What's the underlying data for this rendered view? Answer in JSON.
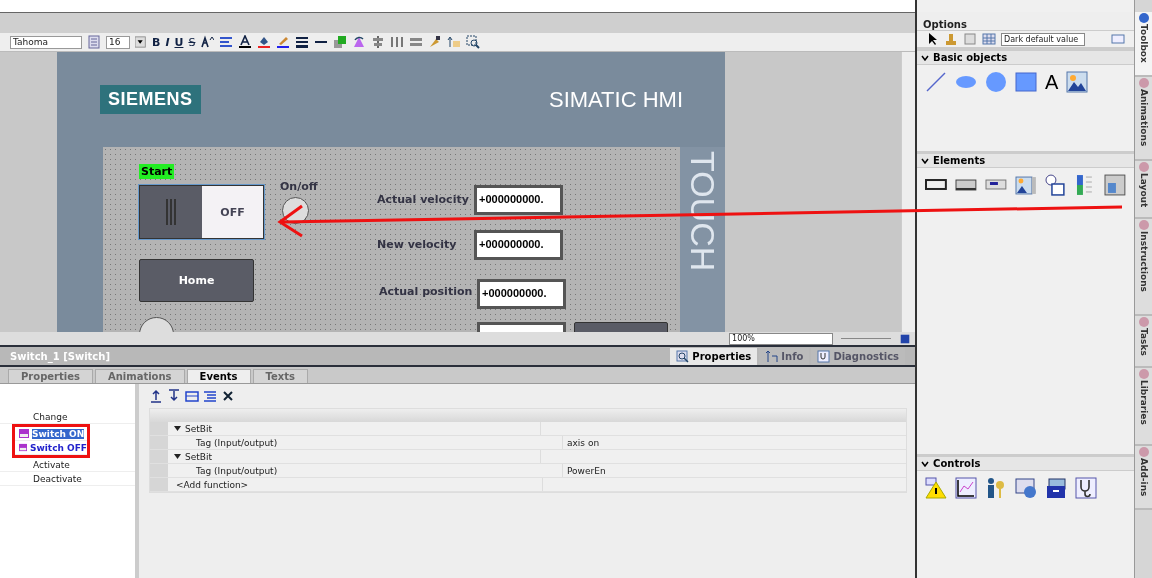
{
  "toolbar": {
    "font": "Tahoma",
    "size": "16",
    "format_buttons": [
      "B",
      "I",
      "U",
      "S"
    ]
  },
  "hmi": {
    "logo": "SIEMENS",
    "product": "SIMATIC HMI",
    "side_label": "TOUCH",
    "objects": [
      {
        "kind": "tag",
        "text": "Start"
      },
      {
        "kind": "switch",
        "text": "OFF",
        "selected": true
      },
      {
        "kind": "label",
        "text": "On/off"
      },
      {
        "kind": "lamp"
      },
      {
        "kind": "button",
        "text": "Home"
      },
      {
        "kind": "lamp"
      },
      {
        "kind": "label",
        "text": "Actual velocity"
      },
      {
        "kind": "field",
        "text": "+000000000."
      },
      {
        "kind": "label",
        "text": "New velocity"
      },
      {
        "kind": "field",
        "text": "+000000000."
      },
      {
        "kind": "label",
        "text": "Actual position"
      },
      {
        "kind": "field",
        "text": "+000000000."
      },
      {
        "kind": "field"
      },
      {
        "kind": "button"
      }
    ]
  },
  "zoom": "100%",
  "inspector": {
    "title": "Switch_1 [Switch]",
    "panel_tabs": [
      {
        "label": "Properties",
        "selected": true
      },
      {
        "label": "Info",
        "selected": false
      },
      {
        "label": "Diagnostics",
        "selected": false
      }
    ],
    "sub_tabs": [
      {
        "label": "Properties",
        "selected": false
      },
      {
        "label": "Animations",
        "selected": false
      },
      {
        "label": "Events",
        "selected": true
      },
      {
        "label": "Texts",
        "selected": false
      }
    ],
    "events": [
      {
        "label": "Change",
        "kind": "plain",
        "selected": false
      },
      {
        "label": "Switch ON",
        "kind": "switch",
        "selected": true
      },
      {
        "label": "Switch OFF",
        "kind": "switch",
        "selected": false
      },
      {
        "label": "Activate",
        "kind": "plain",
        "selected": false
      },
      {
        "label": "Deactivate",
        "kind": "plain",
        "selected": false
      }
    ],
    "functions": [
      {
        "kind": "function",
        "text": "SetBit"
      },
      {
        "kind": "param",
        "text": "Tag (Input/output)",
        "value": "axis on"
      },
      {
        "kind": "function",
        "text": "SetBit"
      },
      {
        "kind": "param",
        "text": "Tag (Input/output)",
        "value": "PowerEn"
      },
      {
        "kind": "add",
        "text": "<Add function>"
      }
    ]
  },
  "options": {
    "title": "Options",
    "style": "Dark default value",
    "sections": [
      {
        "title": "Basic objects",
        "expanded": true,
        "kind": "basic",
        "text_tool": "A"
      },
      {
        "title": "Elements",
        "expanded": true,
        "kind": "elements"
      },
      {
        "title": "Controls",
        "expanded": true,
        "kind": "controls"
      }
    ]
  },
  "side_tabs": [
    {
      "label": "Toolbox",
      "selected": true
    },
    {
      "label": "Animations",
      "selected": false
    },
    {
      "label": "Layout",
      "selected": false
    },
    {
      "label": "Instructions",
      "selected": false
    },
    {
      "label": "Tasks",
      "selected": false
    },
    {
      "label": "Libraries",
      "selected": false
    },
    {
      "label": "Add-ins",
      "selected": false
    }
  ]
}
